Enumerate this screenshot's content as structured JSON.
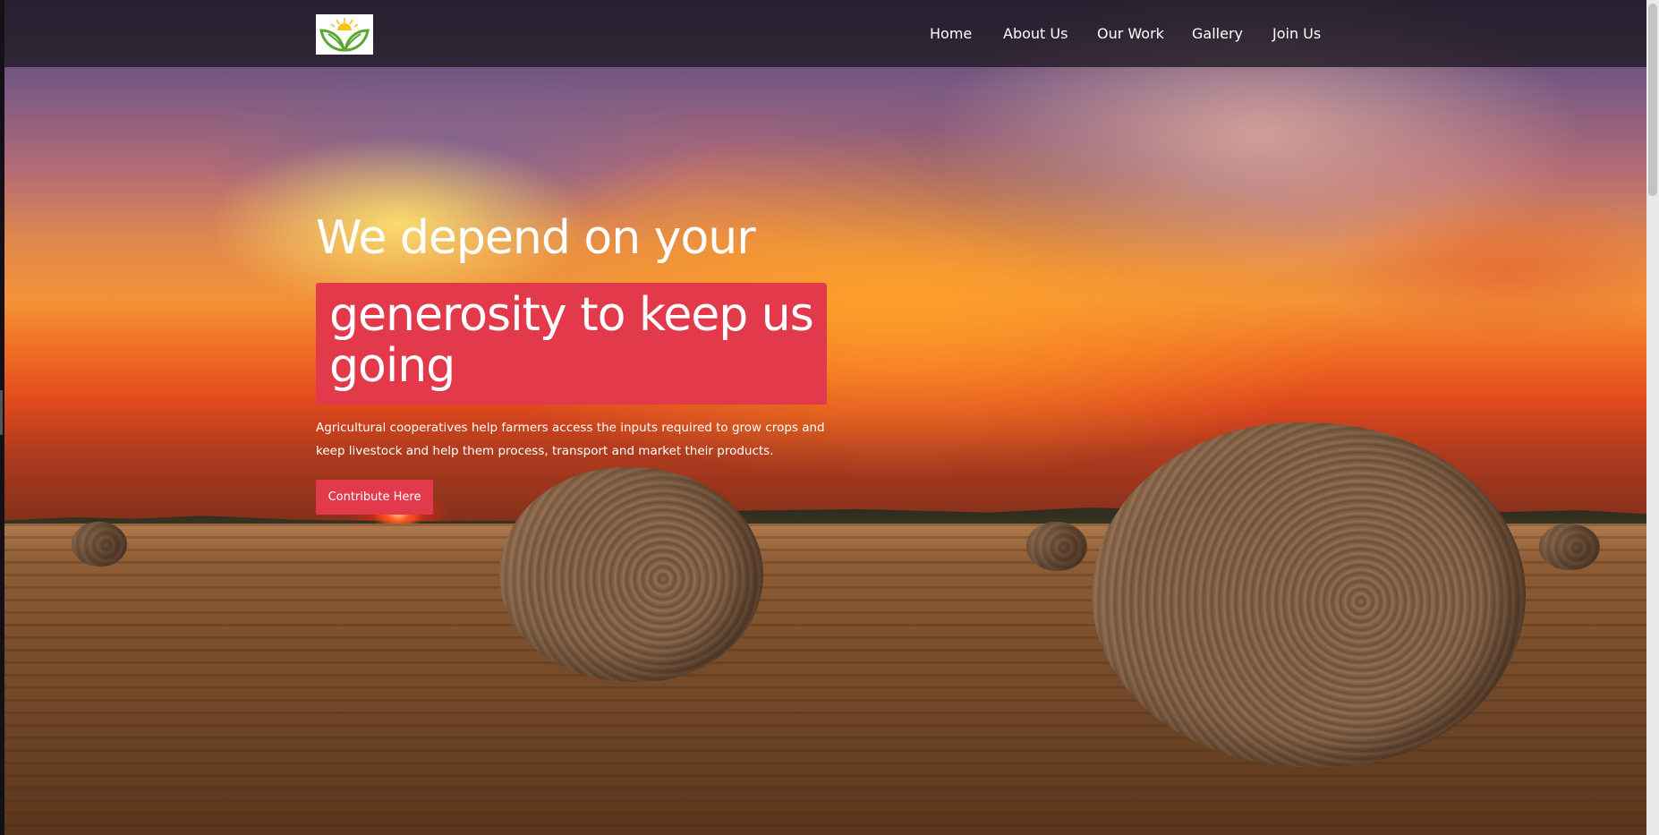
{
  "header": {
    "logo_icon": "sprout-leaves-sun-logo",
    "nav": [
      {
        "label": "Home"
      },
      {
        "label": "About Us"
      },
      {
        "label": "Our Work"
      },
      {
        "label": "Gallery"
      },
      {
        "label": "Join Us"
      }
    ]
  },
  "hero": {
    "title_line1": "We depend on your",
    "title_highlight": "generosity to keep us going",
    "description": "Agricultural cooperatives help farmers access the inputs required to grow crops and keep livestock and help them process, transport and market their products.",
    "cta_label": "Contribute Here"
  },
  "colors": {
    "accent": "#e2394b",
    "header_bg": "#1e1822",
    "text": "#ffffff"
  }
}
